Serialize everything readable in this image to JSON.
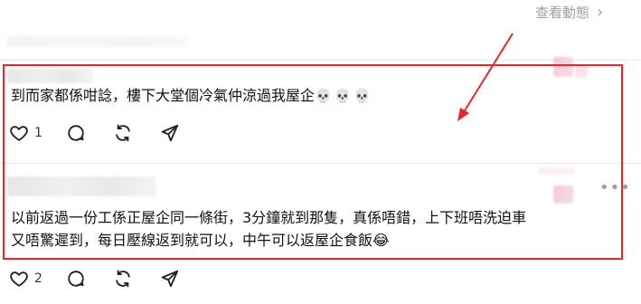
{
  "header": {
    "view_activity_label": "查看動態",
    "chevron_icon": "chevron-right-icon"
  },
  "comments": [
    {
      "text": "到而家都係咁諗，樓下大堂個冷氣仲涼過我屋企",
      "emoji": "💀💀💀",
      "likes": "1"
    },
    {
      "text_line1": "以前返過一份工係正屋企同一條街，3分鐘就到那隻，真係唔錯，上下班唔洗迫車",
      "text_line2": "又唔驚遲到，每日壓線返到就可以，中午可以返屋企食飯",
      "emoji": "😂",
      "likes": "2"
    }
  ],
  "annotation": {
    "highlight_color": "#e8262b"
  },
  "icons": [
    "heart-icon",
    "comment-icon",
    "repost-icon",
    "share-icon",
    "more-icon"
  ]
}
